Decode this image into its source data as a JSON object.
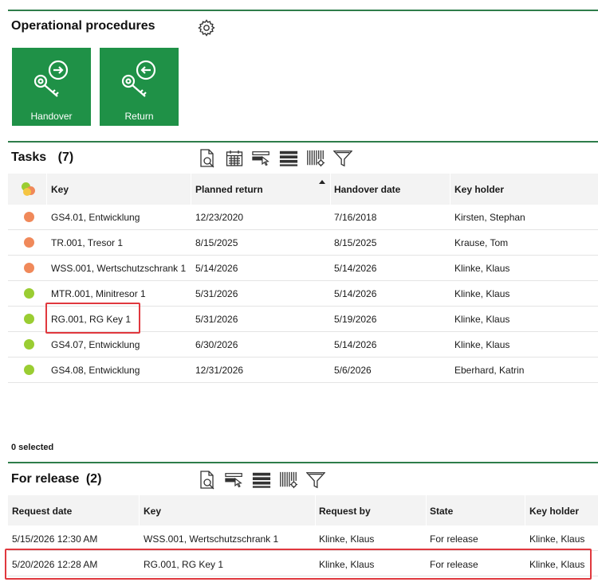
{
  "operational": {
    "title": "Operational procedures",
    "tiles": [
      {
        "label": "Handover",
        "icon": "key-handover-icon"
      },
      {
        "label": "Return",
        "icon": "key-return-icon"
      }
    ],
    "tile_color": "#1f9147"
  },
  "tasks": {
    "title": "Tasks",
    "count": "(7)",
    "columns": [
      "Key",
      "Planned return",
      "Handover date",
      "Key holder"
    ],
    "rows": [
      {
        "status": "orange",
        "key": "GS4.01, Entwicklung",
        "planned": "12/23/2020",
        "handover": "7/16/2018",
        "holder": "Kirsten, Stephan"
      },
      {
        "status": "orange",
        "key": "TR.001, Tresor 1",
        "planned": "8/15/2025",
        "handover": "8/15/2025",
        "holder": "Krause, Tom"
      },
      {
        "status": "orange",
        "key": "WSS.001, Wertschutzschrank 1",
        "planned": "5/14/2026",
        "handover": "5/14/2026",
        "holder": "Klinke, Klaus"
      },
      {
        "status": "green",
        "key": "MTR.001, Minitresor 1",
        "planned": "5/31/2026",
        "handover": "5/14/2026",
        "holder": "Klinke, Klaus"
      },
      {
        "status": "green",
        "key": "RG.001, RG Key 1",
        "planned": "5/31/2026",
        "handover": "5/19/2026",
        "holder": "Klinke, Klaus"
      },
      {
        "status": "green",
        "key": "GS4.07, Entwicklung",
        "planned": "6/30/2026",
        "handover": "5/14/2026",
        "holder": "Klinke, Klaus"
      },
      {
        "status": "green",
        "key": "GS4.08, Entwicklung",
        "planned": "12/31/2026",
        "handover": "5/6/2026",
        "holder": "Eberhard, Katrin"
      }
    ],
    "selected": "0 selected"
  },
  "release": {
    "title": "For release",
    "count": "(2)",
    "columns": [
      "Request date",
      "Key",
      "Request by",
      "State",
      "Key holder"
    ],
    "rows": [
      {
        "date": "5/15/2026 12:30 AM",
        "key": "WSS.001, Wertschutzschrank 1",
        "by": "Klinke, Klaus",
        "state": "For release",
        "holder": "Klinke, Klaus"
      },
      {
        "date": "5/20/2026 12:28 AM",
        "key": "RG.001, RG Key 1",
        "by": "Klinke, Klaus",
        "state": "For release",
        "holder": "Klinke, Klaus"
      }
    ]
  },
  "colors": {
    "orange": "#f0895a",
    "green": "#9acd32",
    "accent": "#2e7d4a",
    "highlight": "#e0383e"
  }
}
